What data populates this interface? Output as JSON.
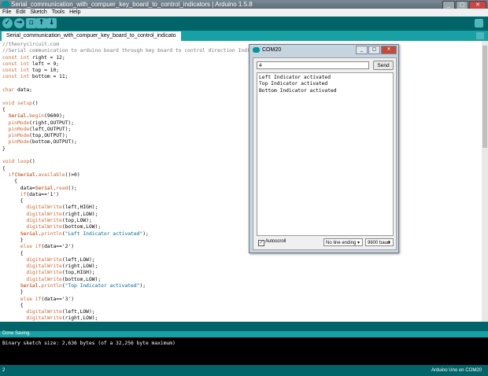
{
  "window": {
    "title": "Serial_communication_with_compuer_key_board_to_control_indicators | Arduino 1.5.8",
    "min": "_",
    "max": "▢",
    "close": "✕"
  },
  "menu": [
    "File",
    "Edit",
    "Sketch",
    "Tools",
    "Help"
  ],
  "toolbar": {
    "verify_icon": "check-icon",
    "upload_icon": "arrow-right-icon",
    "new_icon": "new-file-icon",
    "open_icon": "arrow-up-icon",
    "save_icon": "arrow-down-icon",
    "serial_icon": "magnifier-icon"
  },
  "tab": {
    "label": "Serial_communication_with_compuer_key_board_to_control_indicato"
  },
  "code": [
    {
      "t": "//theorycircuit.com",
      "c": "cmt"
    },
    {
      "t": "//Serial communication to arduino board through key board to control direction Indicators",
      "c": "cmt"
    },
    {
      "t": "const int right = 12;",
      "c": ""
    },
    {
      "t": "const int left = 9;",
      "c": ""
    },
    {
      "t": "const int top = 10;",
      "c": ""
    },
    {
      "t": "const int bottom = 11;",
      "c": ""
    },
    {
      "t": "",
      "c": ""
    },
    {
      "t": "char data;",
      "c": ""
    },
    {
      "t": "",
      "c": ""
    },
    {
      "t": "void setup()",
      "c": ""
    },
    {
      "t": "{",
      "c": ""
    },
    {
      "t": "  Serial.begin(9600);",
      "c": ""
    },
    {
      "t": "  pinMode(right,OUTPUT);",
      "c": ""
    },
    {
      "t": "  pinMode(left,OUTPUT);",
      "c": ""
    },
    {
      "t": "  pinMode(top,OUTPUT);",
      "c": ""
    },
    {
      "t": "  pinMode(bottom,OUTPUT);",
      "c": ""
    },
    {
      "t": "}",
      "c": ""
    },
    {
      "t": "",
      "c": ""
    },
    {
      "t": "void loop()",
      "c": ""
    },
    {
      "t": "{",
      "c": ""
    },
    {
      "t": "  if(Serial.available()>0)",
      "c": ""
    },
    {
      "t": "    {",
      "c": ""
    },
    {
      "t": "      data=Serial.read();",
      "c": ""
    },
    {
      "t": "      if(data=='1')",
      "c": ""
    },
    {
      "t": "      {",
      "c": ""
    },
    {
      "t": "        digitalWrite(left,HIGH);",
      "c": ""
    },
    {
      "t": "        digitalWrite(right,LOW);",
      "c": ""
    },
    {
      "t": "        digitalWrite(top,LOW);",
      "c": ""
    },
    {
      "t": "        digitalWrite(bottom,LOW);",
      "c": ""
    },
    {
      "t": "      Serial.println(\"Left Indicator activated\");",
      "c": ""
    },
    {
      "t": "      }",
      "c": ""
    },
    {
      "t": "      else if(data=='2')",
      "c": ""
    },
    {
      "t": "      {",
      "c": ""
    },
    {
      "t": "        digitalWrite(left,LOW);",
      "c": ""
    },
    {
      "t": "        digitalWrite(right,LOW);",
      "c": ""
    },
    {
      "t": "        digitalWrite(top,HIGH);",
      "c": ""
    },
    {
      "t": "        digitalWrite(bottom,LOW);",
      "c": ""
    },
    {
      "t": "      Serial.println(\"Top Indicator activated\");",
      "c": ""
    },
    {
      "t": "      }",
      "c": ""
    },
    {
      "t": "      else if(data=='3')",
      "c": ""
    },
    {
      "t": "      {",
      "c": ""
    },
    {
      "t": "        digitalWrite(left,LOW);",
      "c": ""
    },
    {
      "t": "        digitalWrite(right,LOW);",
      "c": ""
    }
  ],
  "status": {
    "message": "Done Saving."
  },
  "console": {
    "text": "Binary sketch size: 2,636 bytes (of a 32,256 byte maximum)"
  },
  "footer": {
    "line": "2",
    "board": "Arduino Uno on COM20"
  },
  "serial_monitor": {
    "title": "COM20",
    "min": "_",
    "max": "▢",
    "close": "✕",
    "input_value": "4",
    "send_label": "Send",
    "output": [
      "Left Indicator activated",
      "Top Indicator activated",
      "Bottom Indicator activated"
    ],
    "autoscroll_label": "Autoscroll",
    "autoscroll_checked": "✓",
    "line_ending": "No line ending",
    "baud": "9600 baud",
    "dropdown_arrow": "▼"
  }
}
